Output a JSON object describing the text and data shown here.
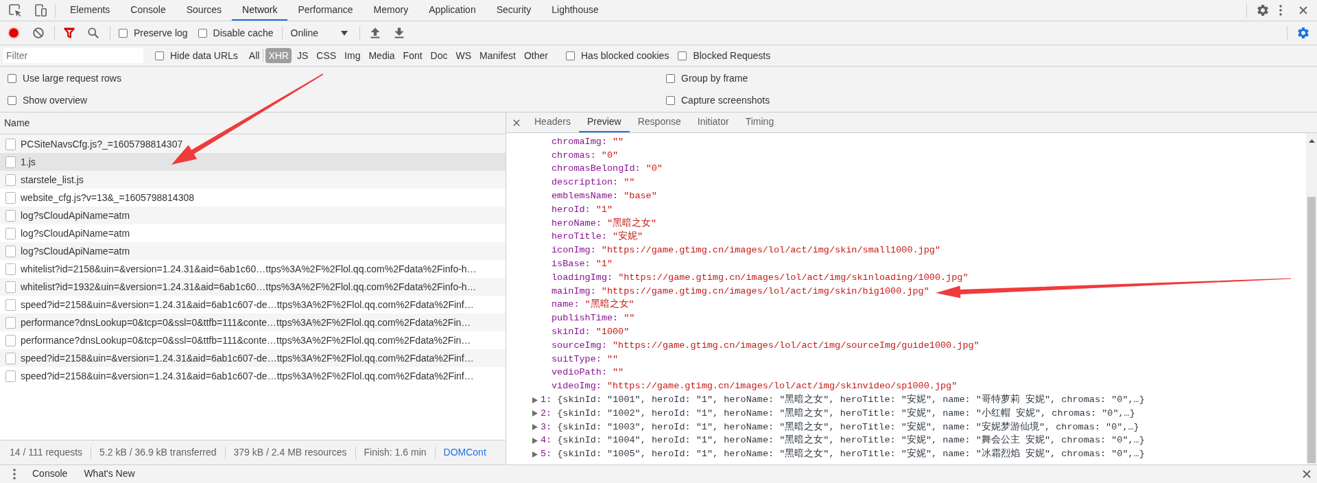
{
  "main_tabs": [
    {
      "label": "Elements",
      "selected": false
    },
    {
      "label": "Console",
      "selected": false
    },
    {
      "label": "Sources",
      "selected": false
    },
    {
      "label": "Network",
      "selected": true
    },
    {
      "label": "Performance",
      "selected": false
    },
    {
      "label": "Memory",
      "selected": false
    },
    {
      "label": "Application",
      "selected": false
    },
    {
      "label": "Security",
      "selected": false
    },
    {
      "label": "Lighthouse",
      "selected": false
    }
  ],
  "network_toolbar": {
    "recording": true,
    "filter_active": true,
    "checkboxes": [
      {
        "label": "Preserve log",
        "checked": false
      },
      {
        "label": "Disable cache",
        "checked": false
      }
    ],
    "throttling": "Online"
  },
  "filter_bar": {
    "placeholder": "Filter",
    "hide_data_urls": {
      "label": "Hide data URLs",
      "checked": false
    },
    "types": [
      {
        "label": "All",
        "selected": false
      },
      {
        "label": "XHR",
        "selected": true
      },
      {
        "label": "JS",
        "selected": false
      },
      {
        "label": "CSS",
        "selected": false
      },
      {
        "label": "Img",
        "selected": false
      },
      {
        "label": "Media",
        "selected": false
      },
      {
        "label": "Font",
        "selected": false
      },
      {
        "label": "Doc",
        "selected": false
      },
      {
        "label": "WS",
        "selected": false
      },
      {
        "label": "Manifest",
        "selected": false
      },
      {
        "label": "Other",
        "selected": false
      }
    ],
    "extra_checkboxes": [
      {
        "label": "Has blocked cookies",
        "checked": false
      },
      {
        "label": "Blocked Requests",
        "checked": false
      }
    ]
  },
  "settings": {
    "left": [
      {
        "label": "Use large request rows",
        "checked": false
      },
      {
        "label": "Show overview",
        "checked": false
      }
    ],
    "right": [
      {
        "label": "Group by frame",
        "checked": false
      },
      {
        "label": "Capture screenshots",
        "checked": false
      }
    ]
  },
  "requests": {
    "column": "Name",
    "rows": [
      {
        "name": "PCSiteNavsCfg.js?_=1605798814307",
        "selected": false
      },
      {
        "name": "1.js",
        "selected": true
      },
      {
        "name": "starstele_list.js",
        "selected": false
      },
      {
        "name": "website_cfg.js?v=13&_=1605798814308",
        "selected": false
      },
      {
        "name": "log?sCloudApiName=atm",
        "selected": false
      },
      {
        "name": "log?sCloudApiName=atm",
        "selected": false
      },
      {
        "name": "log?sCloudApiName=atm",
        "selected": false
      },
      {
        "name": "whitelist?id=2158&uin=&version=1.24.31&aid=6ab1c60…ttps%3A%2F%2Flol.qq.com%2Fdata%2Finfo-h…",
        "selected": false
      },
      {
        "name": "whitelist?id=1932&uin=&version=1.24.31&aid=6ab1c60…ttps%3A%2F%2Flol.qq.com%2Fdata%2Finfo-h…",
        "selected": false
      },
      {
        "name": "speed?id=2158&uin=&version=1.24.31&aid=6ab1c607-de…ttps%3A%2F%2Flol.qq.com%2Fdata%2Finf…",
        "selected": false
      },
      {
        "name": "performance?dnsLookup=0&tcp=0&ssl=0&ttfb=111&conte…ttps%3A%2F%2Flol.qq.com%2Fdata%2Fin…",
        "selected": false
      },
      {
        "name": "performance?dnsLookup=0&tcp=0&ssl=0&ttfb=111&conte…ttps%3A%2F%2Flol.qq.com%2Fdata%2Fin…",
        "selected": false
      },
      {
        "name": "speed?id=2158&uin=&version=1.24.31&aid=6ab1c607-de…ttps%3A%2F%2Flol.qq.com%2Fdata%2Finf…",
        "selected": false
      },
      {
        "name": "speed?id=2158&uin=&version=1.24.31&aid=6ab1c607-de…ttps%3A%2F%2Flol.qq.com%2Fdata%2Finf…",
        "selected": false
      }
    ]
  },
  "status_bar": [
    {
      "kind": "text",
      "text": "14 / 111 requests"
    },
    {
      "kind": "text",
      "text": "5.2 kB / 36.9 kB transferred"
    },
    {
      "kind": "text",
      "text": "379 kB / 2.4 MB resources"
    },
    {
      "kind": "text",
      "text": "Finish: 1.6 min"
    },
    {
      "kind": "link",
      "text": "DOMCont"
    }
  ],
  "detail_tabs": [
    {
      "label": "Headers",
      "selected": false
    },
    {
      "label": "Preview",
      "selected": true
    },
    {
      "label": "Response",
      "selected": false
    },
    {
      "label": "Initiator",
      "selected": false
    },
    {
      "label": "Timing",
      "selected": false
    }
  ],
  "preview": {
    "lines": [
      {
        "kind": "property",
        "key": "chromaImg:",
        "value": "\"\""
      },
      {
        "kind": "property",
        "key": "chromas:",
        "value": "\"0\""
      },
      {
        "kind": "property",
        "key": "chromasBelongId:",
        "value": "\"0\""
      },
      {
        "kind": "property",
        "key": "description:",
        "value": "\"\""
      },
      {
        "kind": "property",
        "key": "emblemsName:",
        "value": "\"base\""
      },
      {
        "kind": "property",
        "key": "heroId:",
        "value": "\"1\""
      },
      {
        "kind": "property",
        "key": "heroName:",
        "value": "\"黑暗之女\""
      },
      {
        "kind": "property",
        "key": "heroTitle:",
        "value": "\"安妮\""
      },
      {
        "kind": "property",
        "key": "iconImg:",
        "value": "\"https://game.gtimg.cn/images/lol/act/img/skin/small1000.jpg\""
      },
      {
        "kind": "property",
        "key": "isBase:",
        "value": "\"1\""
      },
      {
        "kind": "property",
        "key": "loadingImg:",
        "value": "\"https://game.gtimg.cn/images/lol/act/img/skinloading/1000.jpg\""
      },
      {
        "kind": "property",
        "key": "mainImg:",
        "value": "\"https://game.gtimg.cn/images/lol/act/img/skin/big1000.jpg\""
      },
      {
        "kind": "property",
        "key": "name:",
        "value": "\"黑暗之女\""
      },
      {
        "kind": "property",
        "key": "publishTime:",
        "value": "\"\""
      },
      {
        "kind": "property",
        "key": "skinId:",
        "value": "\"1000\""
      },
      {
        "kind": "property",
        "key": "sourceImg:",
        "value": "\"https://game.gtimg.cn/images/lol/act/img/sourceImg/guide1000.jpg\""
      },
      {
        "kind": "property",
        "key": "suitType:",
        "value": "\"\""
      },
      {
        "kind": "property",
        "key": "vedioPath:",
        "value": "\"\""
      },
      {
        "kind": "property",
        "key": "videoImg:",
        "value": "\"https://game.gtimg.cn/images/lol/act/img/skinvideo/sp1000.jpg\""
      },
      {
        "kind": "collapsed",
        "index": "1:",
        "summary": "{skinId: \"1001\", heroId: \"1\", heroName: \"黑暗之女\", heroTitle: \"安妮\", name: \"哥特萝莉 安妮\", chromas: \"0\",…}"
      },
      {
        "kind": "collapsed",
        "index": "2:",
        "summary": "{skinId: \"1002\", heroId: \"1\", heroName: \"黑暗之女\", heroTitle: \"安妮\", name: \"小红帽 安妮\", chromas: \"0\",…}"
      },
      {
        "kind": "collapsed",
        "index": "3:",
        "summary": "{skinId: \"1003\", heroId: \"1\", heroName: \"黑暗之女\", heroTitle: \"安妮\", name: \"安妮梦游仙境\", chromas: \"0\",…}"
      },
      {
        "kind": "collapsed",
        "index": "4:",
        "summary": "{skinId: \"1004\", heroId: \"1\", heroName: \"黑暗之女\", heroTitle: \"安妮\", name: \"舞会公主 安妮\", chromas: \"0\",…}"
      },
      {
        "kind": "collapsed",
        "index": "5:",
        "summary": "{skinId: \"1005\", heroId: \"1\", heroName: \"黑暗之女\", heroTitle: \"安妮\", name: \"冰霜烈焰 安妮\", chromas: \"0\",…}"
      }
    ]
  },
  "drawer_tabs": [
    {
      "label": "Console",
      "selected": false
    },
    {
      "label": "What's New",
      "selected": false
    }
  ]
}
